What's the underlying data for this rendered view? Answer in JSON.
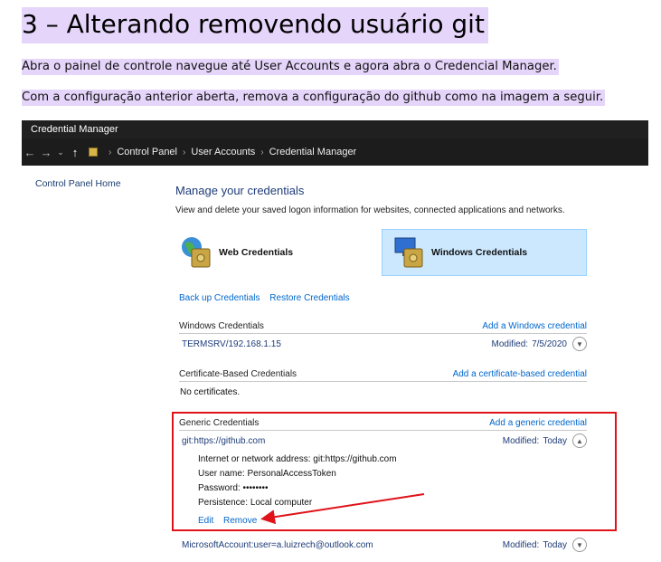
{
  "heading": "3 – Alterando removendo usuário git",
  "paragraph1": "Abra o painel de controle navegue até User Accounts e agora abra o Credencial Manager.",
  "paragraph2": "Com a configuração anterior aberta, remova a configuração do github como na imagem a seguir.",
  "screenshot": {
    "window_title": "Credential Manager",
    "breadcrumb": [
      "Control Panel",
      "User Accounts",
      "Credential Manager"
    ],
    "sidebar_link": "Control Panel Home",
    "manage_title": "Manage your credentials",
    "manage_desc": "View and delete your saved logon information for websites, connected applications and networks.",
    "tiles": {
      "web": "Web Credentials",
      "windows": "Windows Credentials"
    },
    "backup_link": "Back up Credentials",
    "restore_link": "Restore Credentials",
    "windows_section": {
      "title": "Windows Credentials",
      "add": "Add a Windows credential",
      "items": [
        {
          "name": "TERMSRV/192.168.1.15",
          "modified_label": "Modified:",
          "modified": "7/5/2020"
        }
      ]
    },
    "cert_section": {
      "title": "Certificate-Based Credentials",
      "add": "Add a certificate-based credential",
      "empty": "No certificates."
    },
    "generic_section": {
      "title": "Generic Credentials",
      "add": "Add a generic credential",
      "expanded": {
        "name": "git:https://github.com",
        "modified_label": "Modified:",
        "modified": "Today",
        "address_label": "Internet or network address:",
        "address": "git:https://github.com",
        "user_label": "User name:",
        "user": "PersonalAccessToken",
        "password_label": "Password:",
        "password": "••••••••",
        "persistence_label": "Persistence:",
        "persistence": "Local computer",
        "edit": "Edit",
        "remove": "Remove"
      },
      "more": [
        {
          "name": "MicrosoftAccount:user=a.luizrech@outlook.com",
          "modified_label": "Modified:",
          "modified": "Today"
        }
      ]
    },
    "colors": {
      "highlight": "#e6d5fb",
      "annotation_red": "#e0131a",
      "link_blue": "#0066cc",
      "selected_tile": "#cce8ff"
    }
  }
}
